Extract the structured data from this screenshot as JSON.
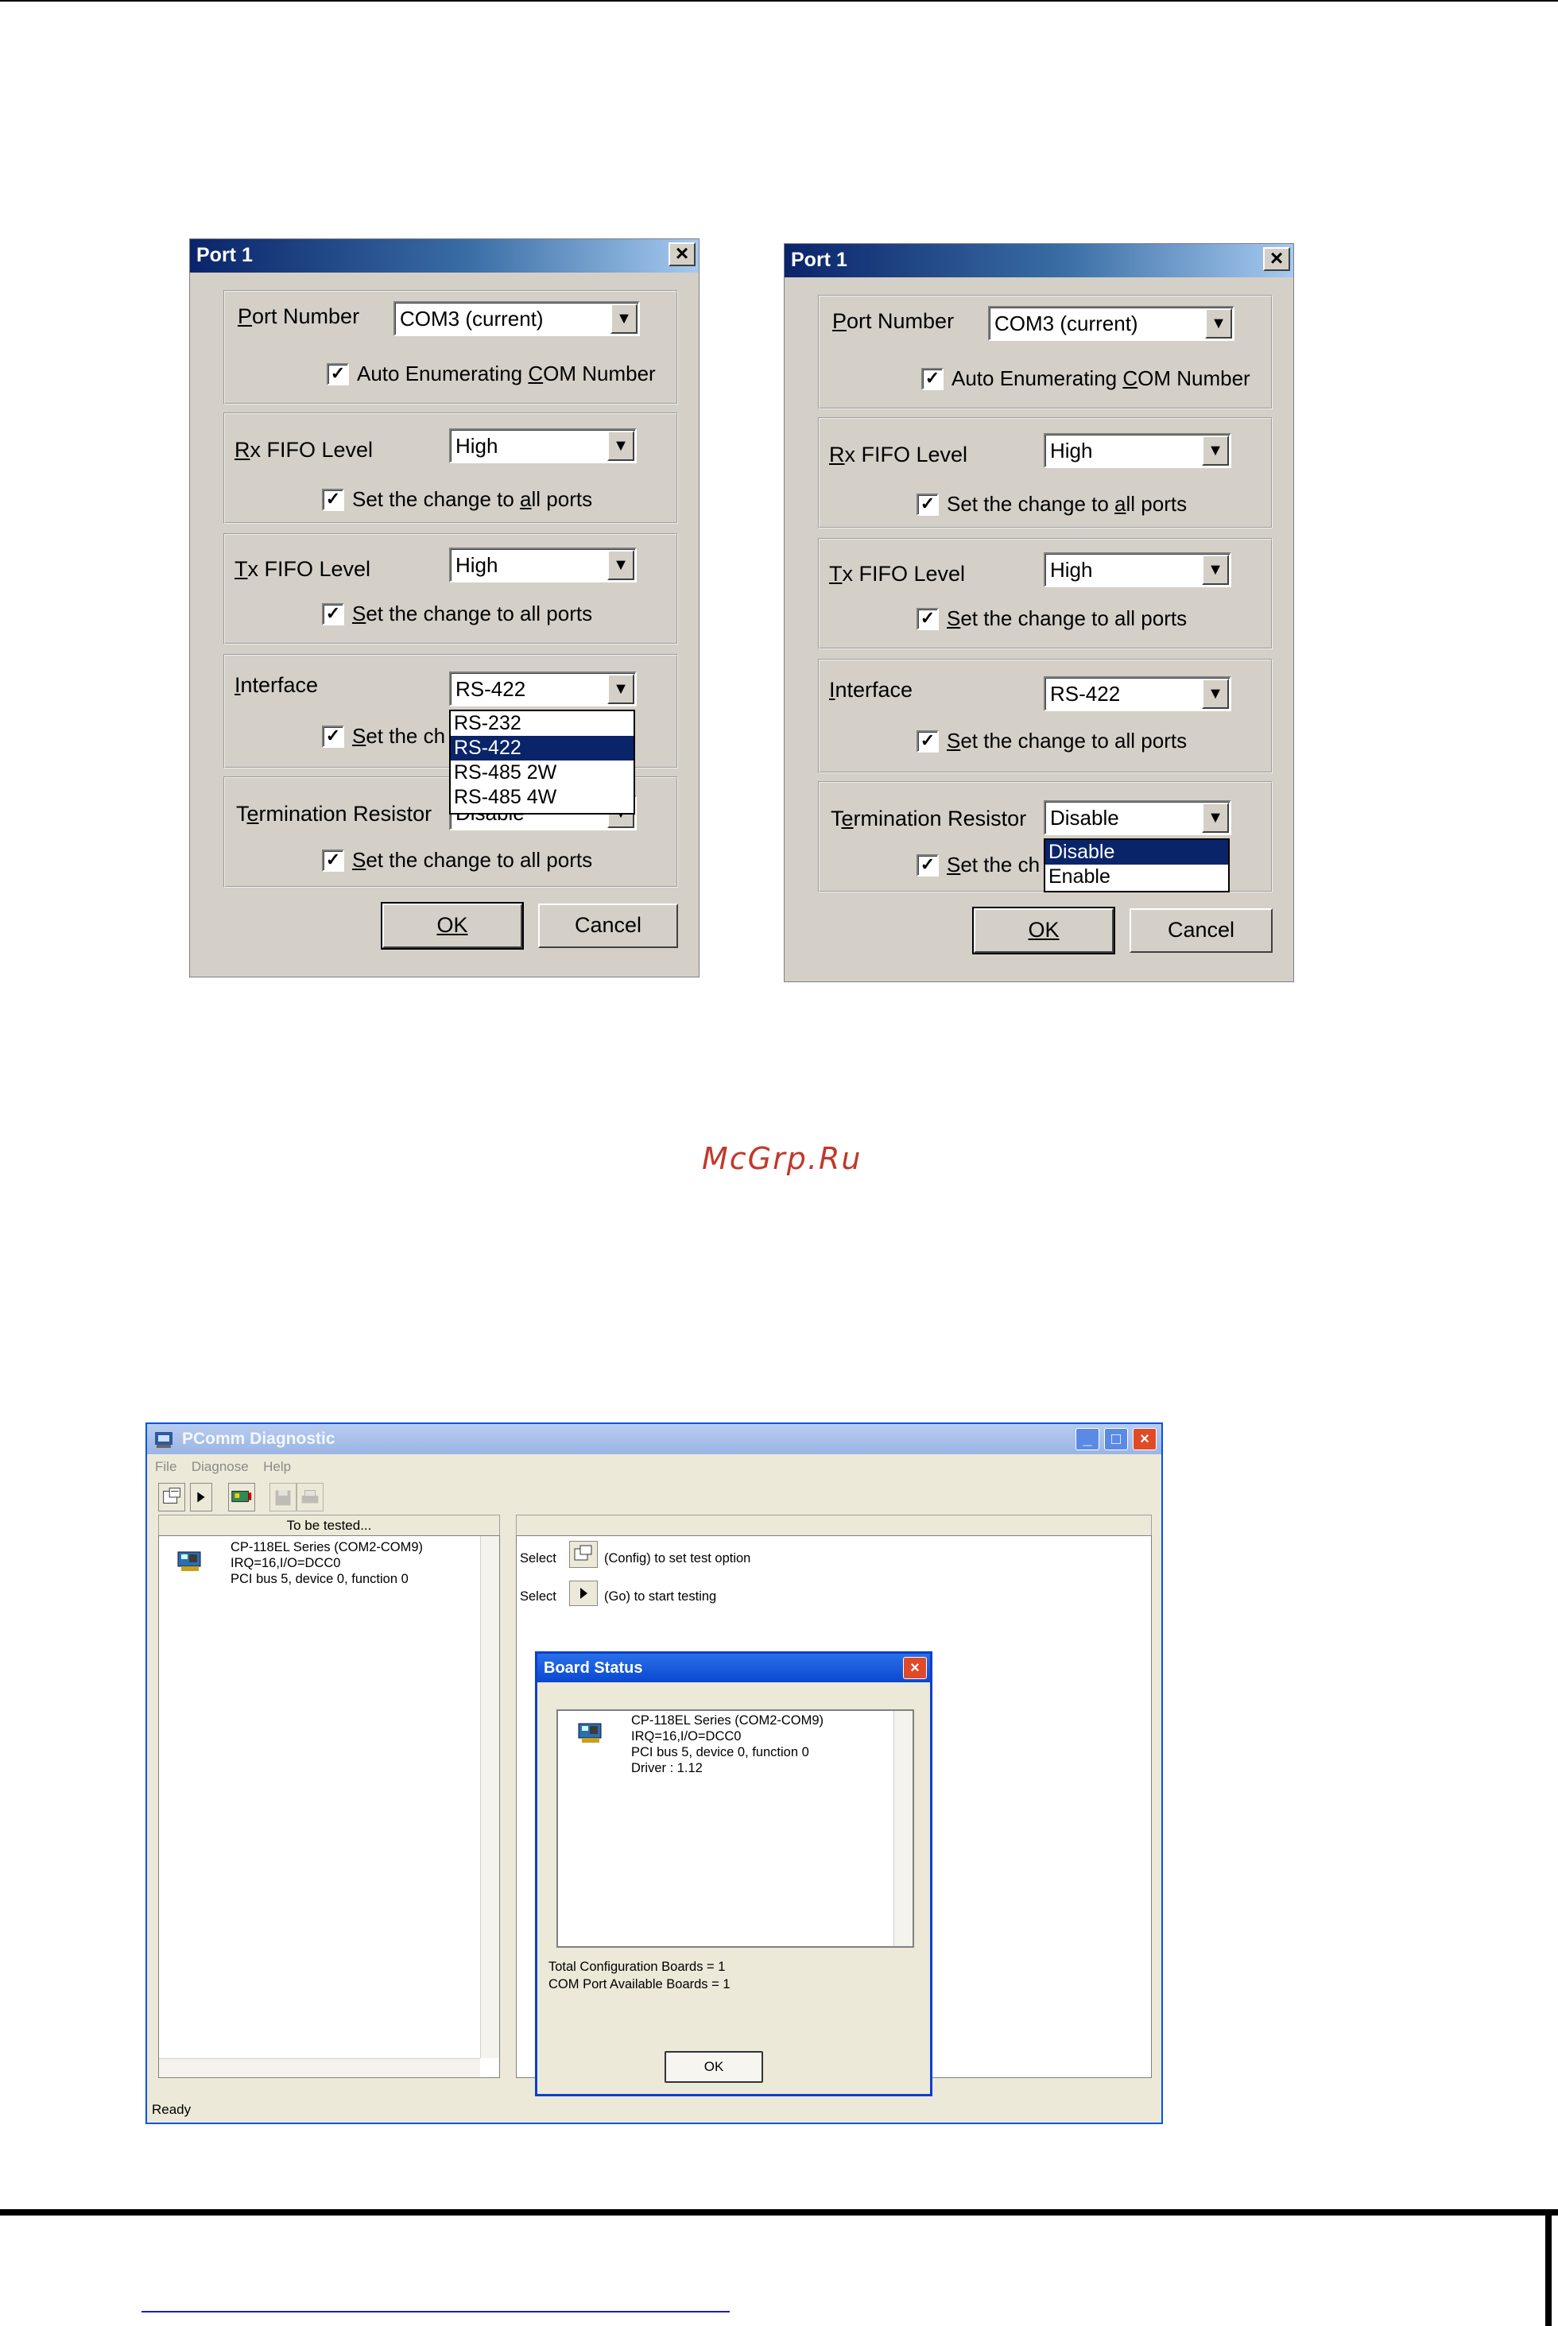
{
  "dialog_left": {
    "title": "Port 1",
    "port_number": {
      "label_pre": "",
      "label_ul": "P",
      "label_post": "ort Number",
      "value": "COM3 (current)"
    },
    "auto_enum": {
      "label_pre": "Auto Enumerating ",
      "label_ul": "C",
      "label_post": "OM Number"
    },
    "rx_fifo": {
      "label_pre": "",
      "label_ul": "R",
      "label_post": "x FIFO Level",
      "value": "High"
    },
    "rx_apply": {
      "label_pre": "Set the change to ",
      "label_ul": "a",
      "label_post": "ll ports"
    },
    "tx_fifo": {
      "label_pre": "",
      "label_ul": "T",
      "label_post": "x FIFO Level",
      "value": "High"
    },
    "tx_apply": {
      "label_pre": "",
      "label_ul": "S",
      "label_post": "et the change to all ports"
    },
    "interface": {
      "label_pre": "",
      "label_ul": "I",
      "label_post": "nterface",
      "value": "RS-422"
    },
    "interface_apply": {
      "label_pre": "",
      "label_ul": "S",
      "label_post": "et the ch"
    },
    "interface_options": [
      "RS-232",
      "RS-422",
      "RS-485 2W",
      "RS-485 4W"
    ],
    "interface_selected_index": 1,
    "termination": {
      "label_pre": "T",
      "label_ul": "e",
      "label_post": "rmination Resistor",
      "value": "Disable"
    },
    "term_apply": {
      "label_pre": "",
      "label_ul": "S",
      "label_post": "et the change to all ports"
    },
    "ok": "OK",
    "cancel": "Cancel"
  },
  "dialog_right": {
    "title": "Port 1",
    "port_number": {
      "label_pre": "",
      "label_ul": "P",
      "label_post": "ort Number",
      "value": "COM3 (current)"
    },
    "auto_enum": {
      "label_pre": "Auto Enumerating ",
      "label_ul": "C",
      "label_post": "OM Number"
    },
    "rx_fifo": {
      "label_pre": "",
      "label_ul": "R",
      "label_post": "x FIFO Level",
      "value": "High"
    },
    "rx_apply": {
      "label_pre": "Set the change to ",
      "label_ul": "a",
      "label_post": "ll ports"
    },
    "tx_fifo": {
      "label_pre": "",
      "label_ul": "T",
      "label_post": "x FIFO Level",
      "value": "High"
    },
    "tx_apply": {
      "label_pre": "",
      "label_ul": "S",
      "label_post": "et the change to all ports"
    },
    "interface": {
      "label_pre": "",
      "label_ul": "I",
      "label_post": "nterface",
      "value": "RS-422"
    },
    "interface_apply": {
      "label_pre": "",
      "label_ul": "S",
      "label_post": "et the change to all ports"
    },
    "termination": {
      "label_pre": "T",
      "label_ul": "e",
      "label_post": "rmination Resistor",
      "value": "Disable"
    },
    "term_apply": {
      "label_pre": "",
      "label_ul": "S",
      "label_post": "et the ch"
    },
    "termination_options": [
      "Disable",
      "Enable"
    ],
    "termination_selected_index": 0,
    "ok": "OK",
    "cancel": "Cancel"
  },
  "watermark": "McGrp.Ru",
  "pcomm": {
    "title": "PComm Diagnostic",
    "menu": [
      "File",
      "Diagnose",
      "Help"
    ],
    "left_header": "To be tested...",
    "board_line1": "CP-118EL Series (COM2-COM9)",
    "board_line2": "IRQ=16,I/O=DCC0",
    "board_line3": "PCI bus 5, device 0, function 0",
    "select1_pre": "Select",
    "select1_post": "(Config) to set test option",
    "select2_pre": "Select",
    "select2_post": "(Go) to start testing",
    "status": "Ready",
    "board_status": {
      "title": "Board Status",
      "line1": "CP-118EL Series (COM2-COM9)",
      "line2": "IRQ=16,I/O=DCC0",
      "line3": "PCI bus 5, device 0, function 0",
      "line4": "Driver : 1.12",
      "total": "Total Configuration Boards = 1",
      "available": "COM Port Available Boards = 1",
      "ok": "OK"
    }
  },
  "colors": {
    "title_active": "#0a246a",
    "selection": "#0a246a",
    "watermark": "#c0392b",
    "xp_border": "#0054e3"
  }
}
